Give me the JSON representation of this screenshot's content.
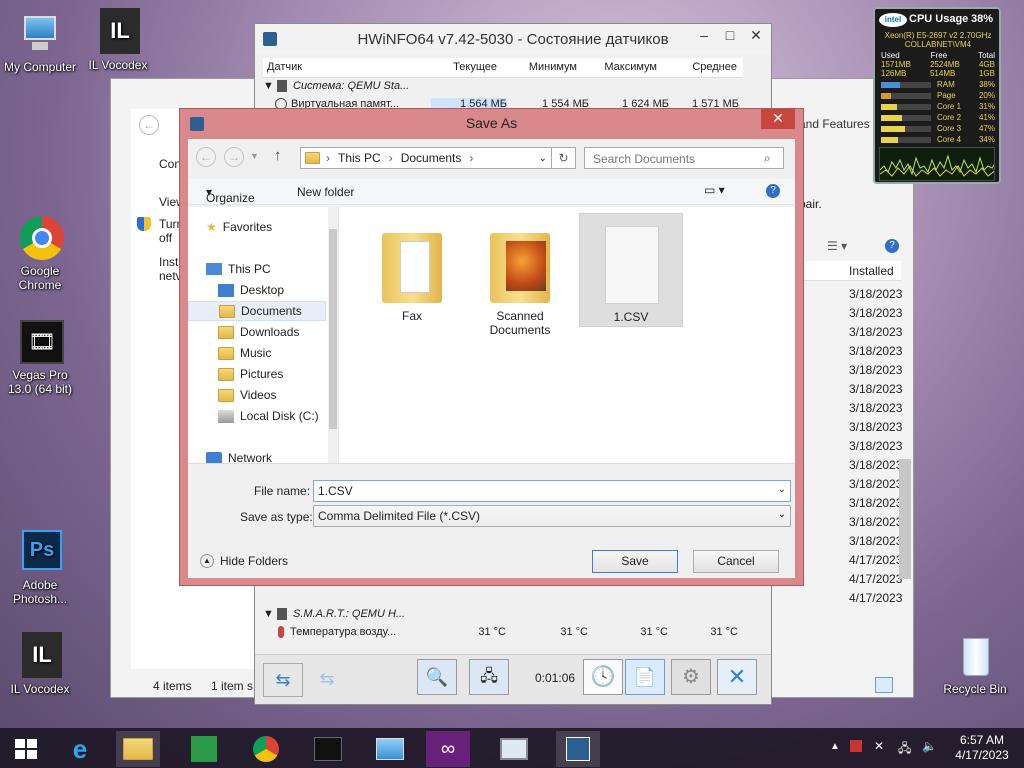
{
  "desktop": {
    "icons": [
      {
        "label": "My Computer"
      },
      {
        "label": "IL Vocodex"
      },
      {
        "label": "Google Chrome"
      },
      {
        "label": "Vegas Pro 13.0 (64 bit)"
      },
      {
        "label": "Adobe Photosh..."
      },
      {
        "label": "IL Vocodex"
      },
      {
        "label": "Recycle Bin"
      }
    ]
  },
  "bg_window": {
    "side_texts": [
      "Con",
      "View",
      "Turn",
      "off",
      "Inst",
      "netv"
    ],
    "features_link": "and Features",
    "repair_text": "pair.",
    "installed_header": "Installed",
    "dates": [
      "3/18/2023",
      "3/18/2023",
      "3/18/2023",
      "3/18/2023",
      "3/18/2023",
      "3/18/2023",
      "3/18/2023",
      "3/18/2023",
      "3/18/2023",
      "3/18/2023",
      "3/18/2023",
      "3/18/2023",
      "3/18/2023",
      "3/18/2023",
      "4/17/2023",
      "4/17/2023",
      "4/17/2023"
    ],
    "status_items": "4 items",
    "status_selected": "1 item s"
  },
  "hwinfo": {
    "title": "HWiNFO64 v7.42-5030 - Состояние датчиков",
    "columns": [
      "Датчик",
      "Текущее",
      "Минимум",
      "Максимум",
      "Среднее"
    ],
    "group1": "Система: QEMU Sta...",
    "row1": {
      "name": "Виртуальная памят...",
      "cur": "1 564 МБ",
      "min": "1 554 МБ",
      "max": "1 624 МБ",
      "avg": "1 571 МБ"
    },
    "group2": "S.M.A.R.T.: QEMU H...",
    "row2": {
      "name": "Температура возду...",
      "cur": "31 °C",
      "min": "31 °C",
      "max": "31 °C",
      "avg": "31 °C"
    },
    "timer": "0:01:06"
  },
  "dialog": {
    "title": "Save As",
    "breadcrumb": [
      "This PC",
      "Documents"
    ],
    "search_placeholder": "Search Documents",
    "organize": "Organize",
    "new_folder": "New folder",
    "nav": {
      "favorites": "Favorites",
      "this_pc": "This PC",
      "desktop": "Desktop",
      "documents": "Documents",
      "downloads": "Downloads",
      "music": "Music",
      "pictures": "Pictures",
      "videos": "Videos",
      "local_disk": "Local Disk (C:)",
      "network": "Network"
    },
    "files": [
      {
        "name": "Fax"
      },
      {
        "name": "Scanned Documents"
      },
      {
        "name": "1.CSV"
      }
    ],
    "file_name_label": "File name:",
    "file_name_value": "1.CSV",
    "save_type_label": "Save as type:",
    "save_type_value": "Comma Delimited File (*.CSV)",
    "hide_folders": "Hide Folders",
    "save": "Save",
    "cancel": "Cancel"
  },
  "gadget": {
    "title": "CPU Usage",
    "total_percent": "38%",
    "cpu_name": "Xeon(R) E5-2697 v2 2.70GHz",
    "host": "COLLABNET\\VM4",
    "mem_headers": [
      "Used",
      "Free",
      "Total"
    ],
    "mem_row1": [
      "1571MB",
      "2524MB",
      "4GB"
    ],
    "mem_row2": [
      "126MB",
      "514MB",
      "1GB"
    ],
    "bars": [
      {
        "label": "RAM",
        "value": "38%",
        "level": 0.38
      },
      {
        "label": "Page",
        "value": "20%",
        "level": 0.2
      },
      {
        "label": "Core 1",
        "value": "31%",
        "level": 0.31
      },
      {
        "label": "Core 2",
        "value": "41%",
        "level": 0.41
      },
      {
        "label": "Core 3",
        "value": "47%",
        "level": 0.47
      },
      {
        "label": "Core 4",
        "value": "34%",
        "level": 0.34
      }
    ]
  },
  "taskbar": {
    "time": "6:57 AM",
    "date": "4/17/2023"
  }
}
